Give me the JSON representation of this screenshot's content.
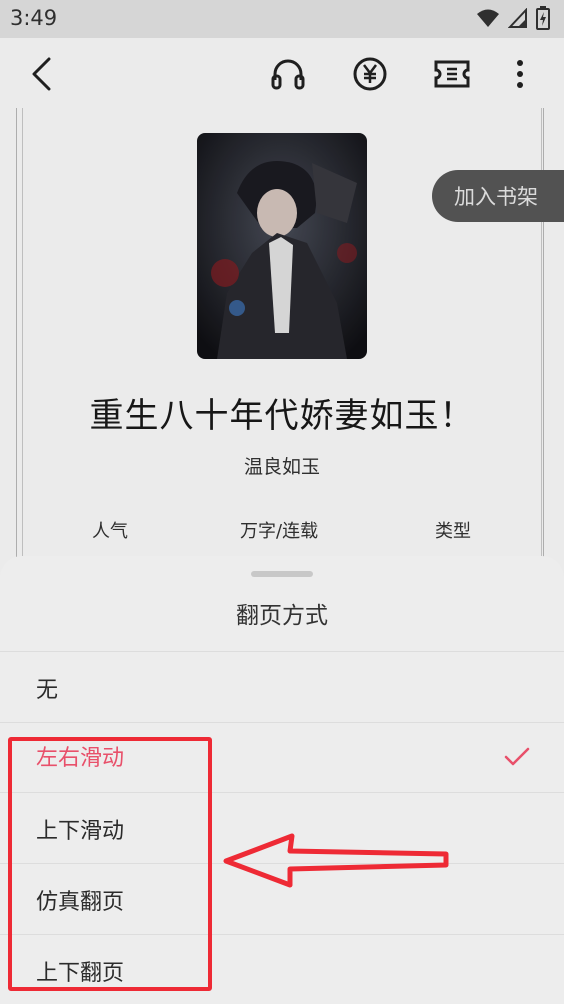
{
  "status_bar": {
    "time": "3:49",
    "icons": [
      "wifi-icon",
      "cell-signal-icon",
      "battery-icon"
    ]
  },
  "app_bar": {
    "icons": [
      "back-icon",
      "headphones-icon",
      "yuan-icon",
      "ticket-icon",
      "more-vert-icon"
    ]
  },
  "book": {
    "title": "重生八十年代娇妻如玉！",
    "author": "温良如玉",
    "add_to_shelf": "加入书架",
    "stats": {
      "popularity_label": "人气",
      "words_status_label": "万字/连载",
      "type_label": "类型"
    }
  },
  "sheet": {
    "title": "翻页方式",
    "options": [
      {
        "label": "无",
        "selected": false
      },
      {
        "label": "左右滑动",
        "selected": true
      },
      {
        "label": "上下滑动",
        "selected": false
      },
      {
        "label": "仿真翻页",
        "selected": false
      },
      {
        "label": "上下翻页",
        "selected": false
      }
    ]
  },
  "colors": {
    "accent": "#e8506a",
    "annotation": "#ee2a35",
    "sheet_bg": "#ededed"
  }
}
